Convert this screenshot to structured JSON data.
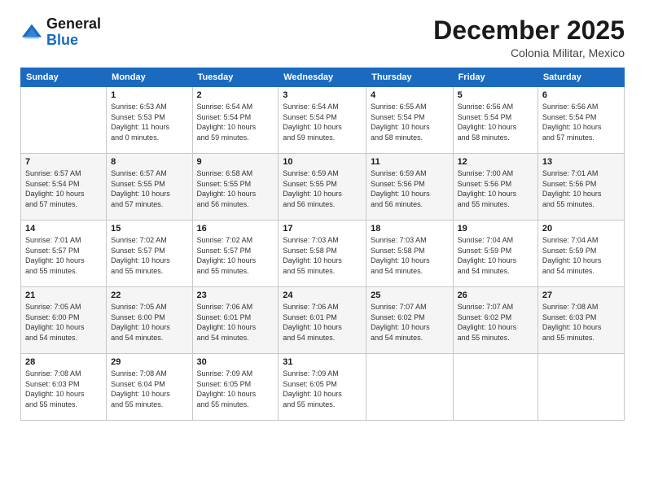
{
  "header": {
    "logo_general": "General",
    "logo_blue": "Blue",
    "month": "December 2025",
    "location": "Colonia Militar, Mexico"
  },
  "days_of_week": [
    "Sunday",
    "Monday",
    "Tuesday",
    "Wednesday",
    "Thursday",
    "Friday",
    "Saturday"
  ],
  "weeks": [
    [
      {
        "day": "",
        "info": ""
      },
      {
        "day": "1",
        "info": "Sunrise: 6:53 AM\nSunset: 5:53 PM\nDaylight: 11 hours\nand 0 minutes."
      },
      {
        "day": "2",
        "info": "Sunrise: 6:54 AM\nSunset: 5:54 PM\nDaylight: 10 hours\nand 59 minutes."
      },
      {
        "day": "3",
        "info": "Sunrise: 6:54 AM\nSunset: 5:54 PM\nDaylight: 10 hours\nand 59 minutes."
      },
      {
        "day": "4",
        "info": "Sunrise: 6:55 AM\nSunset: 5:54 PM\nDaylight: 10 hours\nand 58 minutes."
      },
      {
        "day": "5",
        "info": "Sunrise: 6:56 AM\nSunset: 5:54 PM\nDaylight: 10 hours\nand 58 minutes."
      },
      {
        "day": "6",
        "info": "Sunrise: 6:56 AM\nSunset: 5:54 PM\nDaylight: 10 hours\nand 57 minutes."
      }
    ],
    [
      {
        "day": "7",
        "info": "Sunrise: 6:57 AM\nSunset: 5:54 PM\nDaylight: 10 hours\nand 57 minutes."
      },
      {
        "day": "8",
        "info": "Sunrise: 6:57 AM\nSunset: 5:55 PM\nDaylight: 10 hours\nand 57 minutes."
      },
      {
        "day": "9",
        "info": "Sunrise: 6:58 AM\nSunset: 5:55 PM\nDaylight: 10 hours\nand 56 minutes."
      },
      {
        "day": "10",
        "info": "Sunrise: 6:59 AM\nSunset: 5:55 PM\nDaylight: 10 hours\nand 56 minutes."
      },
      {
        "day": "11",
        "info": "Sunrise: 6:59 AM\nSunset: 5:56 PM\nDaylight: 10 hours\nand 56 minutes."
      },
      {
        "day": "12",
        "info": "Sunrise: 7:00 AM\nSunset: 5:56 PM\nDaylight: 10 hours\nand 55 minutes."
      },
      {
        "day": "13",
        "info": "Sunrise: 7:01 AM\nSunset: 5:56 PM\nDaylight: 10 hours\nand 55 minutes."
      }
    ],
    [
      {
        "day": "14",
        "info": "Sunrise: 7:01 AM\nSunset: 5:57 PM\nDaylight: 10 hours\nand 55 minutes."
      },
      {
        "day": "15",
        "info": "Sunrise: 7:02 AM\nSunset: 5:57 PM\nDaylight: 10 hours\nand 55 minutes."
      },
      {
        "day": "16",
        "info": "Sunrise: 7:02 AM\nSunset: 5:57 PM\nDaylight: 10 hours\nand 55 minutes."
      },
      {
        "day": "17",
        "info": "Sunrise: 7:03 AM\nSunset: 5:58 PM\nDaylight: 10 hours\nand 55 minutes."
      },
      {
        "day": "18",
        "info": "Sunrise: 7:03 AM\nSunset: 5:58 PM\nDaylight: 10 hours\nand 54 minutes."
      },
      {
        "day": "19",
        "info": "Sunrise: 7:04 AM\nSunset: 5:59 PM\nDaylight: 10 hours\nand 54 minutes."
      },
      {
        "day": "20",
        "info": "Sunrise: 7:04 AM\nSunset: 5:59 PM\nDaylight: 10 hours\nand 54 minutes."
      }
    ],
    [
      {
        "day": "21",
        "info": "Sunrise: 7:05 AM\nSunset: 6:00 PM\nDaylight: 10 hours\nand 54 minutes."
      },
      {
        "day": "22",
        "info": "Sunrise: 7:05 AM\nSunset: 6:00 PM\nDaylight: 10 hours\nand 54 minutes."
      },
      {
        "day": "23",
        "info": "Sunrise: 7:06 AM\nSunset: 6:01 PM\nDaylight: 10 hours\nand 54 minutes."
      },
      {
        "day": "24",
        "info": "Sunrise: 7:06 AM\nSunset: 6:01 PM\nDaylight: 10 hours\nand 54 minutes."
      },
      {
        "day": "25",
        "info": "Sunrise: 7:07 AM\nSunset: 6:02 PM\nDaylight: 10 hours\nand 54 minutes."
      },
      {
        "day": "26",
        "info": "Sunrise: 7:07 AM\nSunset: 6:02 PM\nDaylight: 10 hours\nand 55 minutes."
      },
      {
        "day": "27",
        "info": "Sunrise: 7:08 AM\nSunset: 6:03 PM\nDaylight: 10 hours\nand 55 minutes."
      }
    ],
    [
      {
        "day": "28",
        "info": "Sunrise: 7:08 AM\nSunset: 6:03 PM\nDaylight: 10 hours\nand 55 minutes."
      },
      {
        "day": "29",
        "info": "Sunrise: 7:08 AM\nSunset: 6:04 PM\nDaylight: 10 hours\nand 55 minutes."
      },
      {
        "day": "30",
        "info": "Sunrise: 7:09 AM\nSunset: 6:05 PM\nDaylight: 10 hours\nand 55 minutes."
      },
      {
        "day": "31",
        "info": "Sunrise: 7:09 AM\nSunset: 6:05 PM\nDaylight: 10 hours\nand 55 minutes."
      },
      {
        "day": "",
        "info": ""
      },
      {
        "day": "",
        "info": ""
      },
      {
        "day": "",
        "info": ""
      }
    ]
  ]
}
